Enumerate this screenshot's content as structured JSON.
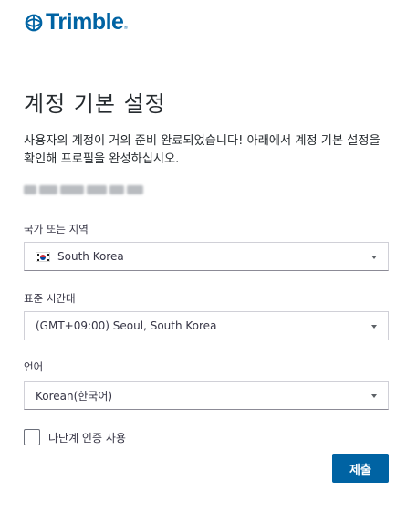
{
  "brand": {
    "name": "Trimble",
    "mark": "®",
    "color": "#0063a3"
  },
  "title": "계정 기본 설정",
  "intro": "사용자의 계정이 거의 준비 완료되었습니다! 아래에서 계정 기본 설정을 확인해 프로필을 완성하십시오.",
  "email_redacted": true,
  "fields": {
    "country": {
      "label": "국가 또는 지역",
      "value": "South Korea",
      "flag_icon": "south-korea-flag-icon"
    },
    "timezone": {
      "label": "표준 시간대",
      "value": "(GMT+09:00) Seoul, South Korea"
    },
    "language": {
      "label": "언어",
      "value": "Korean(한국어)"
    }
  },
  "mfa_checkbox": {
    "label": "다단계 인증 사용",
    "checked": false
  },
  "submit_label": "제출",
  "colors": {
    "accent": "#0063a3",
    "text": "#252a2e",
    "field_border": "#d0d0d7"
  }
}
